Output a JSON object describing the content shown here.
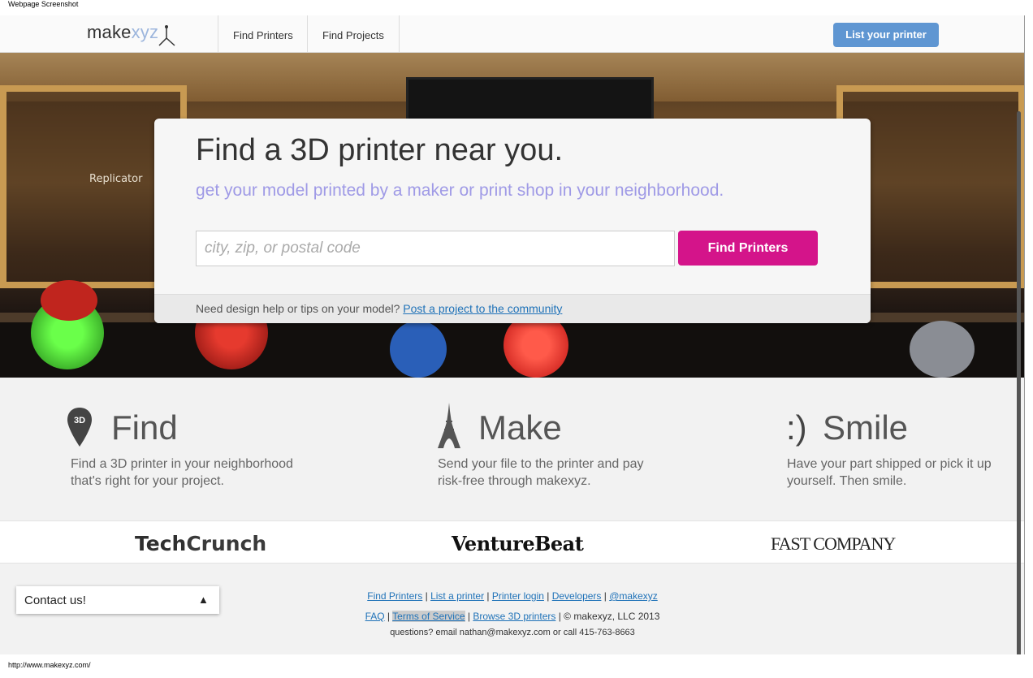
{
  "caption": "Webpage Screenshot",
  "status_url": "http://www.makexyz.com/",
  "header": {
    "logo_main": "make",
    "logo_accent": "xyz",
    "nav": [
      "Find Printers",
      "Find Projects"
    ],
    "cta": "List your printer"
  },
  "hero": {
    "replicator_label": "Replicator",
    "title": "Find a 3D printer near you.",
    "subtitle": "get your model printed by a maker or print shop in your neighborhood.",
    "search_placeholder": "city, zip, or postal code",
    "search_button": "Find Printers",
    "help_text": "Need design help or tips on your model?",
    "help_link": "Post a project to the community"
  },
  "features": [
    {
      "title": "Find",
      "icon": "3d-map-pin-icon",
      "icon_text": "3D",
      "line1": "Find a 3D printer in your neighborhood",
      "line2": "that's right for your project."
    },
    {
      "title": "Make",
      "icon": "eiffel-tower-icon",
      "line1": "Send your file to the printer and pay",
      "line2": "risk-free through makexyz."
    },
    {
      "title": "Smile",
      "icon": "smiley-icon",
      "icon_text": ":)",
      "line1": "Have your part shipped or pick it up",
      "line2": "yourself. Then smile."
    }
  ],
  "press": {
    "techcrunch_a": "Tech",
    "techcrunch_b": "Crunch",
    "venturebeat": "VentureBeat",
    "fastcompany": "FAST COMPANY"
  },
  "footer": {
    "contact": "Contact us!",
    "row1": [
      "Find Printers",
      "List a printer",
      "Printer login",
      "Developers",
      "@makexyz"
    ],
    "row2_links": [
      "FAQ",
      "Terms of Service",
      "Browse 3D printers"
    ],
    "copyright": "© makexyz, LLC 2013",
    "contact_line": "questions? email nathan@makexyz.com or call 415-763-8663"
  },
  "colors": {
    "accent_pink": "#d4148a",
    "accent_blue": "#5f96d2",
    "subtitle_purple": "#9f9ae6"
  }
}
